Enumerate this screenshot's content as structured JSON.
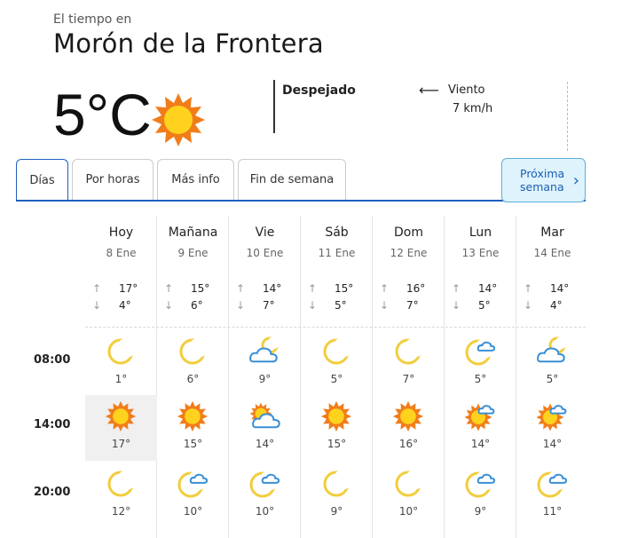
{
  "header": {
    "subtitle": "El tiempo en",
    "city": "Morón de la Frontera",
    "temperature": "5°C",
    "sky": "Despejado",
    "wind_label": "Viento",
    "wind_value": "7 km/h",
    "wind_arrow": "⟵"
  },
  "tabs": [
    {
      "label": "Días",
      "active": true
    },
    {
      "label": "Por horas",
      "active": false
    },
    {
      "label": "Más info",
      "active": false
    },
    {
      "label": "Fin de semana",
      "active": false
    }
  ],
  "next_button": {
    "line1": "Próxima",
    "line2": "semana",
    "chevron": "›"
  },
  "max_arrow": "↑",
  "min_arrow": "↓",
  "days": [
    {
      "name": "Hoy",
      "date": "8 Ene",
      "max": "17°",
      "min": "4°"
    },
    {
      "name": "Mañana",
      "date": "9 Ene",
      "max": "15°",
      "min": "6°"
    },
    {
      "name": "Vie",
      "date": "10 Ene",
      "max": "14°",
      "min": "7°"
    },
    {
      "name": "Sáb",
      "date": "11 Ene",
      "max": "15°",
      "min": "5°"
    },
    {
      "name": "Dom",
      "date": "12 Ene",
      "max": "16°",
      "min": "7°"
    },
    {
      "name": "Lun",
      "date": "13 Ene",
      "max": "14°",
      "min": "5°"
    },
    {
      "name": "Mar",
      "date": "14 Ene",
      "max": "14°",
      "min": "4°"
    }
  ],
  "rows": [
    {
      "time": "08:00",
      "cells": [
        {
          "icon": "moon-icon",
          "temp": "1°"
        },
        {
          "icon": "moon-icon",
          "temp": "6°"
        },
        {
          "icon": "moon-cloud-icon",
          "temp": "9°"
        },
        {
          "icon": "moon-icon",
          "temp": "5°"
        },
        {
          "icon": "moon-icon",
          "temp": "7°"
        },
        {
          "icon": "moon-small-cloud-icon",
          "temp": "5°"
        },
        {
          "icon": "moon-cloud-icon",
          "temp": "5°"
        }
      ]
    },
    {
      "time": "14:00",
      "cells": [
        {
          "icon": "sun-icon",
          "temp": "17°"
        },
        {
          "icon": "sun-icon",
          "temp": "15°"
        },
        {
          "icon": "sun-cloud-icon",
          "temp": "14°"
        },
        {
          "icon": "sun-icon",
          "temp": "15°"
        },
        {
          "icon": "sun-icon",
          "temp": "16°"
        },
        {
          "icon": "sun-small-cloud-icon",
          "temp": "14°"
        },
        {
          "icon": "sun-small-cloud-icon",
          "temp": "14°"
        }
      ]
    },
    {
      "time": "20:00",
      "cells": [
        {
          "icon": "moon-icon",
          "temp": "12°"
        },
        {
          "icon": "moon-small-cloud-icon",
          "temp": "10°"
        },
        {
          "icon": "moon-small-cloud-icon",
          "temp": "10°"
        },
        {
          "icon": "moon-icon",
          "temp": "9°"
        },
        {
          "icon": "moon-icon",
          "temp": "10°"
        },
        {
          "icon": "moon-small-cloud-icon",
          "temp": "9°"
        },
        {
          "icon": "moon-small-cloud-icon",
          "temp": "11°"
        }
      ]
    }
  ],
  "colors": {
    "accent": "#1f5fbf",
    "sun_core": "#ffd21e",
    "sun_rays": "#f07d1a",
    "moon": "#f2cd3c",
    "cloud": "#3a8fd6"
  }
}
